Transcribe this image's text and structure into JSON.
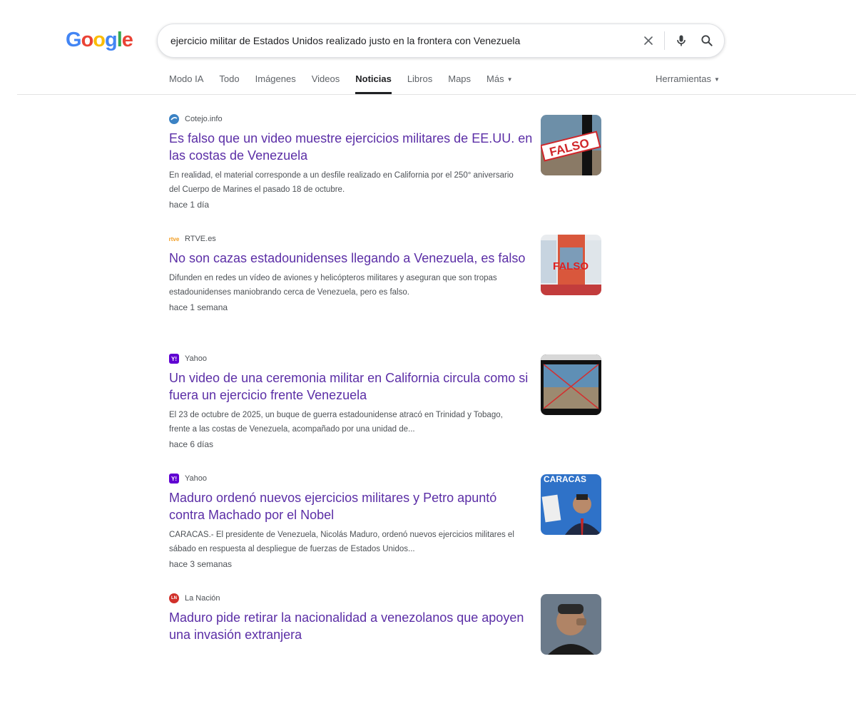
{
  "logo": {
    "letters": [
      "G",
      "o",
      "o",
      "g",
      "l",
      "e"
    ],
    "colors": [
      "#4285F4",
      "#EA4335",
      "#FBBC05",
      "#4285F4",
      "#34A853",
      "#EA4335"
    ]
  },
  "search": {
    "query": "ejercicio militar de Estados Unidos realizado justo en la frontera con Venezuela"
  },
  "tabs": [
    {
      "label": "Modo IA"
    },
    {
      "label": "Todo"
    },
    {
      "label": "Imágenes"
    },
    {
      "label": "Videos"
    },
    {
      "label": "Noticias",
      "active": true
    },
    {
      "label": "Libros"
    },
    {
      "label": "Maps"
    },
    {
      "label": "Más"
    }
  ],
  "tools": {
    "label": "Herramientas"
  },
  "results": [
    {
      "source": "Cotejo.info",
      "favicon_color": "#3b82c4",
      "title": "Es falso que un video muestre ejercicios militares de EE.UU. en las costas de Venezuela",
      "snippet": "En realidad, el material corresponde a un desfile realizado en California por el 250° aniversario del Cuerpo de Marines el pasado 18 de octubre.",
      "time": "hace 1 día",
      "thumb_text": "FALSO"
    },
    {
      "source": "RTVE.es",
      "favicon_text": "rtve",
      "favicon_color": "#f29b1d",
      "title": "No son cazas estadounidenses llegando a Venezuela, es falso",
      "snippet": "Difunden en redes un vídeo de aviones y helicópteros militares y aseguran que son tropas estadounidenses maniobrando cerca de Venezuela, pero es falso.",
      "time": "hace 1 semana",
      "thumb_text": "FALSO"
    },
    {
      "source": "Yahoo",
      "favicon_text": "Y!",
      "favicon_color": "#6001d2",
      "title": "Un video de una ceremonia militar en California circula como si fuera un ejercicio frente Venezuela",
      "snippet": "El 23 de octubre de 2025, un buque de guerra estadounidense atracó en Trinidad y Tobago, frente a las costas de Venezuela, acompañado por una unidad de...",
      "time": "hace 6 días"
    },
    {
      "source": "Yahoo",
      "favicon_text": "Y!",
      "favicon_color": "#6001d2",
      "title": "Maduro ordenó nuevos ejercicios militares y Petro apuntó contra Machado por el Nobel",
      "snippet": "CARACAS.- El presidente de Venezuela, Nicolás Maduro, ordenó nuevos ejercicios militares el sábado en respuesta al despliegue de fuerzas de Estados Unidos...",
      "time": "hace 3 semanas",
      "thumb_text": "CARACAS"
    },
    {
      "source": "La Nación",
      "favicon_text": "LN",
      "favicon_color": "#d1302a",
      "title": "Maduro pide retirar la nacionalidad a venezolanos que apoyen una invasión extranjera",
      "snippet": "",
      "time": ""
    }
  ]
}
